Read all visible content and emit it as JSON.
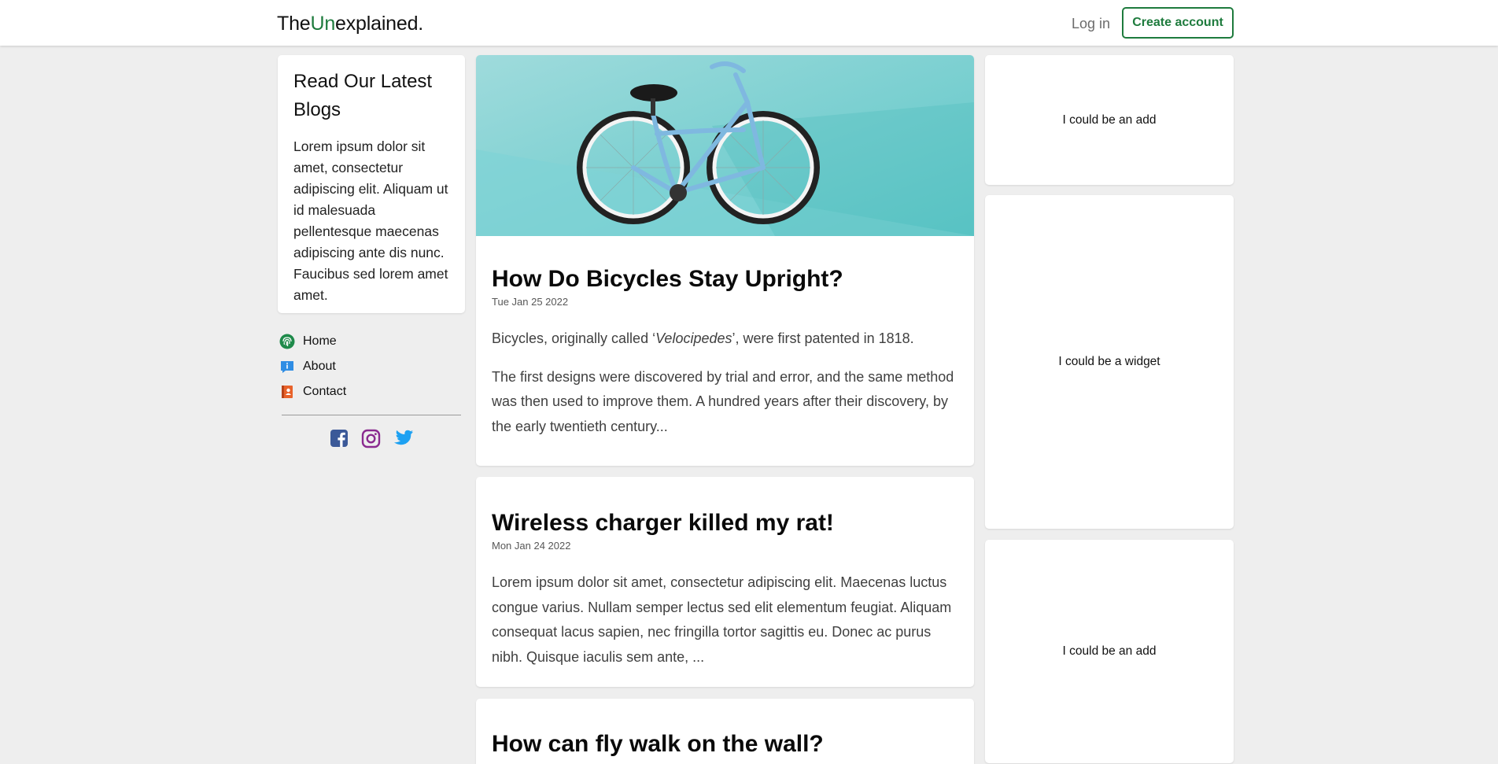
{
  "header": {
    "logo_prefix": "The",
    "logo_accent": "Un",
    "logo_suffix": "explained.",
    "login_label": "Log in",
    "create_account_label": "Create account"
  },
  "intro": {
    "title": "Read Our Latest Blogs",
    "text": "Lorem ipsum dolor sit amet, consectetur adipiscing elit. Aliquam ut id malesuada pellentesque maecenas adipiscing ante dis nunc. Faucibus sed lorem amet amet."
  },
  "nav": {
    "items": [
      {
        "label": "Home",
        "icon": "fingerprint-icon"
      },
      {
        "label": "About",
        "icon": "info-icon"
      },
      {
        "label": "Contact",
        "icon": "contact-book-icon"
      }
    ]
  },
  "social": {
    "icons": [
      "facebook-icon",
      "instagram-icon",
      "twitter-icon"
    ]
  },
  "posts": [
    {
      "title": "How Do Bicycles Stay Upright?",
      "date": "Tue Jan 25 2022",
      "p1_before": "Bicycles, originally called ‘",
      "p1_em": "Velocipedes",
      "p1_after": "’, were first patented in 1818.",
      "p2": "The first designs were discovered by trial and error, and the same method was then used to improve them. A hundred years after their discovery, by the early twentieth century..."
    },
    {
      "title": "Wireless charger killed my rat!",
      "date": "Mon Jan 24 2022",
      "p1": "Lorem ipsum dolor sit amet, consectetur adipiscing elit. Maecenas luctus congue varius. Nullam semper lectus sed elit elementum feugiat. Aliquam consequat lacus sapien, nec fringilla tortor sagittis eu. Donec ac purus nibh. Quisque iaculis sem ante, ..."
    },
    {
      "title": "How can fly walk on the wall?"
    }
  ],
  "widgets": [
    {
      "label": "I could be an add"
    },
    {
      "label": "I could be a widget"
    },
    {
      "label": "I could be an add"
    }
  ],
  "colors": {
    "brand_green": "#1e7b3d",
    "page_background": "#eeeeee",
    "facebook": "#3b5998",
    "instagram": "#8a2a8f",
    "twitter": "#1da1f2"
  }
}
